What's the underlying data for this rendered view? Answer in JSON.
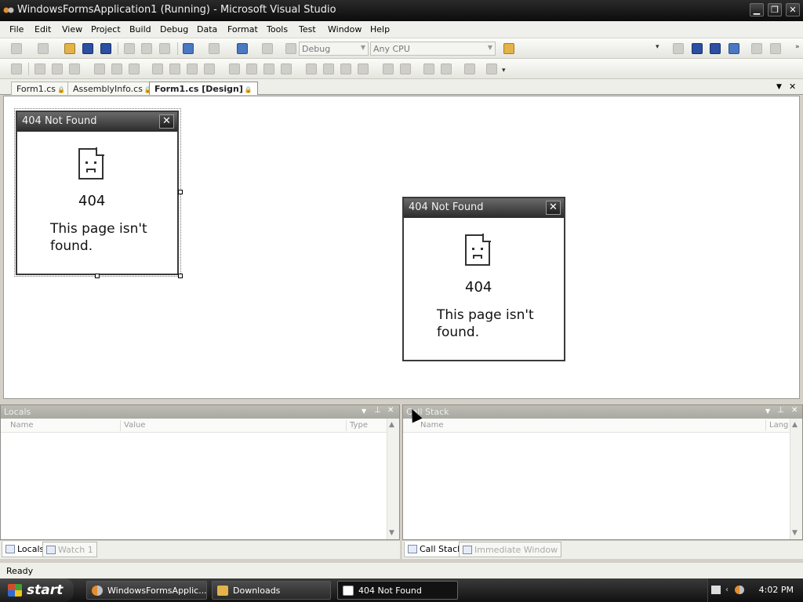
{
  "window": {
    "title": "WindowsFormsApplication1 (Running) - Microsoft Visual Studio"
  },
  "menu": [
    "File",
    "Edit",
    "View",
    "Project",
    "Build",
    "Debug",
    "Data",
    "Format",
    "Tools",
    "Test",
    "Window",
    "Help"
  ],
  "toolbar": {
    "config": "Debug",
    "platform": "Any CPU"
  },
  "doc_tabs": [
    {
      "label": "Form1.cs",
      "active": false
    },
    {
      "label": "AssemblyInfo.cs",
      "active": false
    },
    {
      "label": "Form1.cs [Design]",
      "active": true
    }
  ],
  "form_designer": {
    "title": "404 Not Found",
    "code": "404",
    "message": "This page isn't found."
  },
  "form_running": {
    "title": "404 Not Found",
    "code": "404",
    "message": "This page isn't found."
  },
  "locals": {
    "title": "Locals",
    "columns": [
      "Name",
      "Value",
      "Type"
    ]
  },
  "callstack": {
    "title": "Call Stack",
    "columns": [
      "Name",
      "Lang"
    ]
  },
  "bottom_tabs_left": [
    "Locals",
    "Watch 1"
  ],
  "bottom_tabs_right": [
    "Call Stack",
    "Immediate Window"
  ],
  "status": "Ready",
  "taskbar": {
    "start": "start",
    "tasks": [
      "WindowsFormsApplic...",
      "Downloads",
      "404 Not Found"
    ],
    "time": "4:02 PM"
  }
}
